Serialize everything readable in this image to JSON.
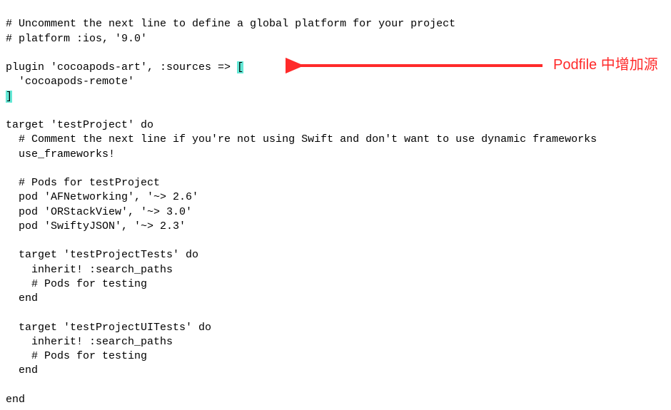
{
  "code": {
    "l1": "# Uncomment the next line to define a global platform for your project",
    "l2": "# platform :ios, '9.0'",
    "l3": "",
    "l4a": "plugin 'cocoapods-art', :sources => ",
    "l4b": "[",
    "l5": "  'cocoapods-remote'",
    "l6": "]",
    "l7": "",
    "l8": "target 'testProject' do",
    "l9": "  # Comment the next line if you're not using Swift and don't want to use dynamic frameworks",
    "l10": "  use_frameworks!",
    "l11": "",
    "l12": "  # Pods for testProject",
    "l13": "  pod 'AFNetworking', '~> 2.6'",
    "l14": "  pod 'ORStackView', '~> 3.0'",
    "l15": "  pod 'SwiftyJSON', '~> 2.3'",
    "l16": "",
    "l17": "  target 'testProjectTests' do",
    "l18": "    inherit! :search_paths",
    "l19": "    # Pods for testing",
    "l20": "  end",
    "l21": "",
    "l22": "  target 'testProjectUITests' do",
    "l23": "    inherit! :search_paths",
    "l24": "    # Pods for testing",
    "l25": "  end",
    "l26": "",
    "l27": "end"
  },
  "annotation": {
    "text": "Podfile 中增加源"
  }
}
